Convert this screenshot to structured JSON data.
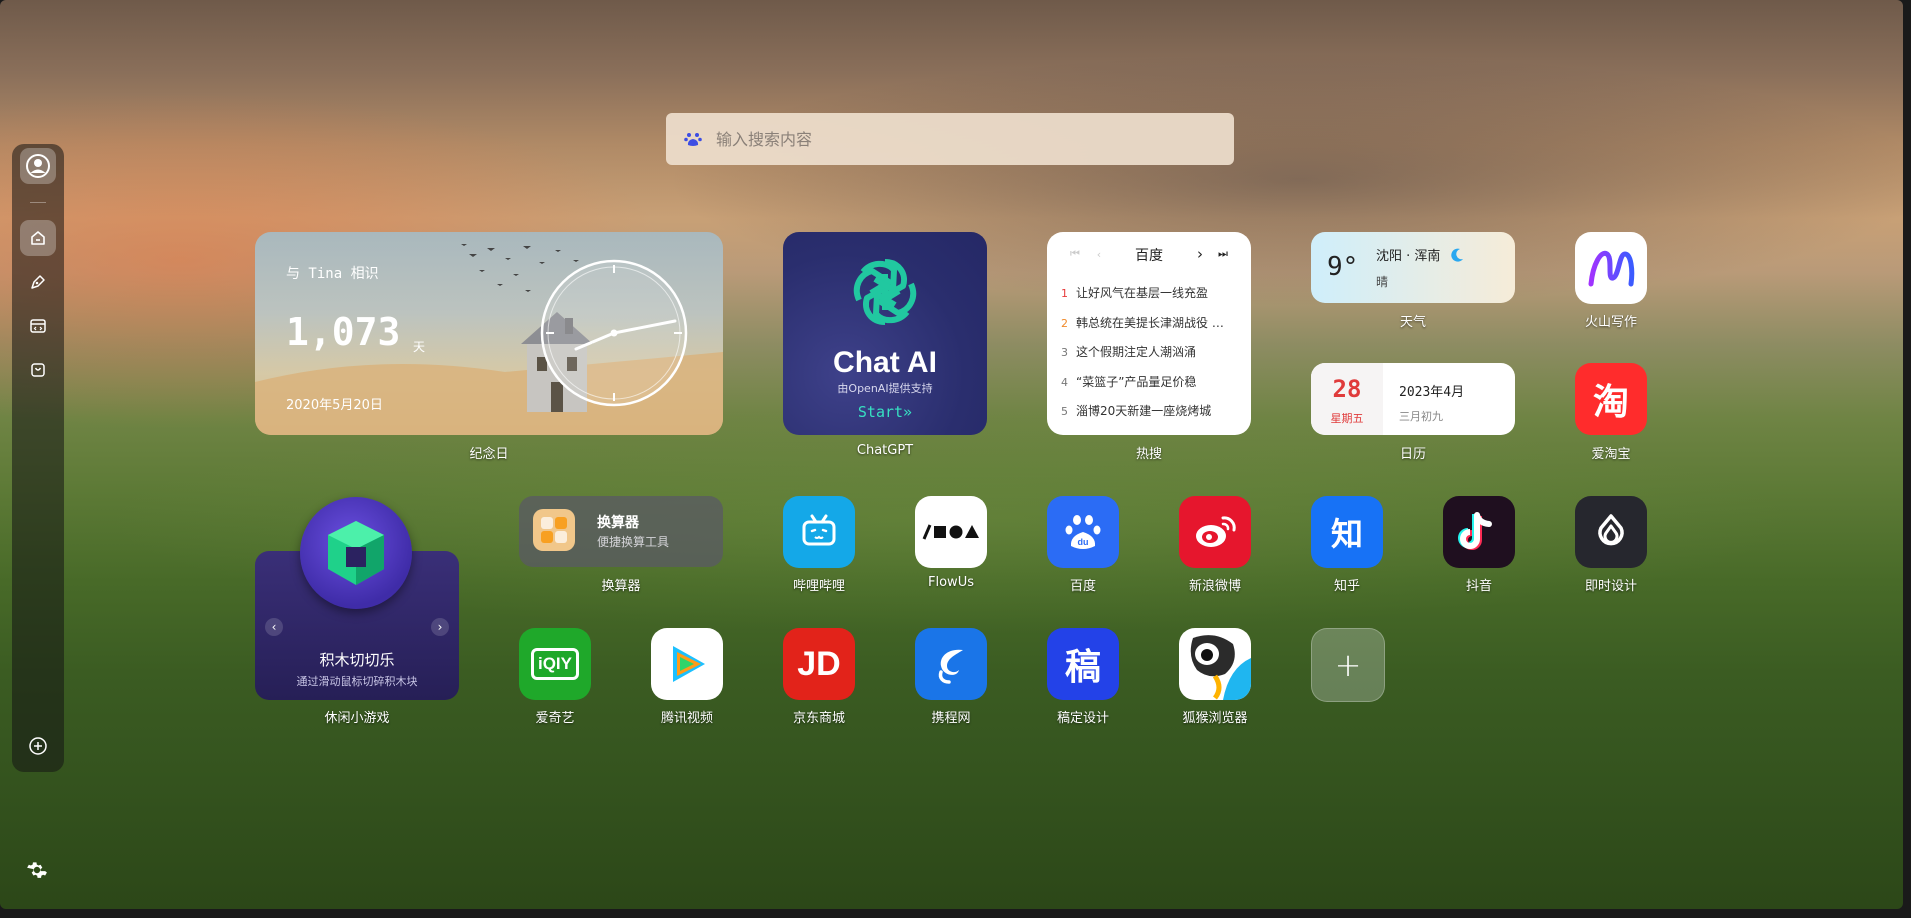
{
  "search": {
    "placeholder": "输入搜索内容"
  },
  "sidebar": {
    "items": [
      {
        "name": "avatar"
      },
      {
        "name": "home"
      },
      {
        "name": "design"
      },
      {
        "name": "developer"
      },
      {
        "name": "shopping"
      },
      {
        "name": "add"
      }
    ]
  },
  "anniversary": {
    "title": "与 Tina 相识",
    "count": "1,073",
    "unit": "天",
    "date": "2020年5月20日",
    "label": "纪念日"
  },
  "chatgpt": {
    "title": "Chat AI",
    "subtitle": "由OpenAI提供支持",
    "start": "Start»",
    "label": "ChatGPT"
  },
  "hot": {
    "source": "百度",
    "label": "热搜",
    "items": [
      {
        "rank": "1",
        "text": "让好风气在基层一线充盈",
        "color": "#e63b3b"
      },
      {
        "rank": "2",
        "text": "韩总统在美提长津湖战役 …",
        "color": "#f08a2b"
      },
      {
        "rank": "3",
        "text": "这个假期注定人潮汹涌",
        "color": "#777777"
      },
      {
        "rank": "4",
        "text": "“菜篮子”产品量足价稳",
        "color": "#777777"
      },
      {
        "rank": "5",
        "text": "淄博20天新建一座烧烤城",
        "color": "#777777"
      }
    ]
  },
  "weather": {
    "temp": "9°",
    "city": "沈阳 · 浑南",
    "condition": "晴",
    "label": "天气"
  },
  "calendar": {
    "day": "28",
    "weekday": "星期五",
    "year_month": "2023年4月",
    "lunar": "三月初九",
    "label": "日历"
  },
  "game": {
    "name": "积木切切乐",
    "desc": "通过滑动鼠标切碎积木块",
    "label": "休闲小游戏",
    "prev": "‹",
    "next": "›"
  },
  "calculator": {
    "name": "换算器",
    "desc": "便捷换算工具",
    "label": "换算器"
  },
  "apps": {
    "huoshan": {
      "label": "火山写作"
    },
    "taobao": {
      "label": "爱淘宝",
      "glyph": "淘"
    },
    "bilibili": {
      "label": "哔哩哔哩"
    },
    "flowus": {
      "label": "FlowUs"
    },
    "baidu": {
      "label": "百度"
    },
    "weibo": {
      "label": "新浪微博"
    },
    "zhihu": {
      "label": "知乎",
      "glyph": "知"
    },
    "douyin": {
      "label": "抖音"
    },
    "jishi": {
      "label": "即时设计"
    },
    "iqiyi": {
      "label": "爱奇艺",
      "glyph": "iQIY"
    },
    "tencent": {
      "label": "腾讯视频"
    },
    "jd": {
      "label": "京东商城",
      "glyph": "JD"
    },
    "ctrip": {
      "label": "携程网"
    },
    "gaoding": {
      "label": "稿定设计",
      "glyph": "稿"
    },
    "firefox": {
      "label": "狐猴浏览器"
    },
    "add": {
      "glyph": "+"
    }
  }
}
